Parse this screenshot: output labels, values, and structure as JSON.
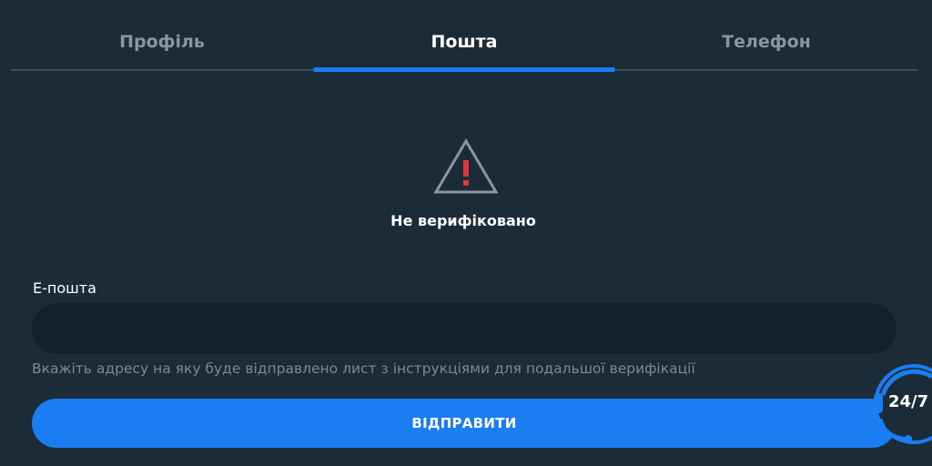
{
  "tabs": [
    {
      "label": "Профіль",
      "active": false
    },
    {
      "label": "Пошта",
      "active": true
    },
    {
      "label": "Телефон",
      "active": false
    }
  ],
  "status": {
    "icon": "warning-triangle-icon",
    "text": "Не верифіковано",
    "icon_color": "#8c959d",
    "mark_color": "#e0363c"
  },
  "email": {
    "label": "E-пошта",
    "value": "",
    "placeholder": "",
    "hint": "Вкажіть адресу на яку буде відправлено лист з інструкціями для подальшої верифікації"
  },
  "submit": {
    "label": "ВІДПРАВИТИ"
  },
  "support": {
    "icon": "headset-icon",
    "label": "24/7"
  },
  "colors": {
    "background": "#1c2b38",
    "accent": "#1a7ef2",
    "input_bg": "#14212b"
  }
}
